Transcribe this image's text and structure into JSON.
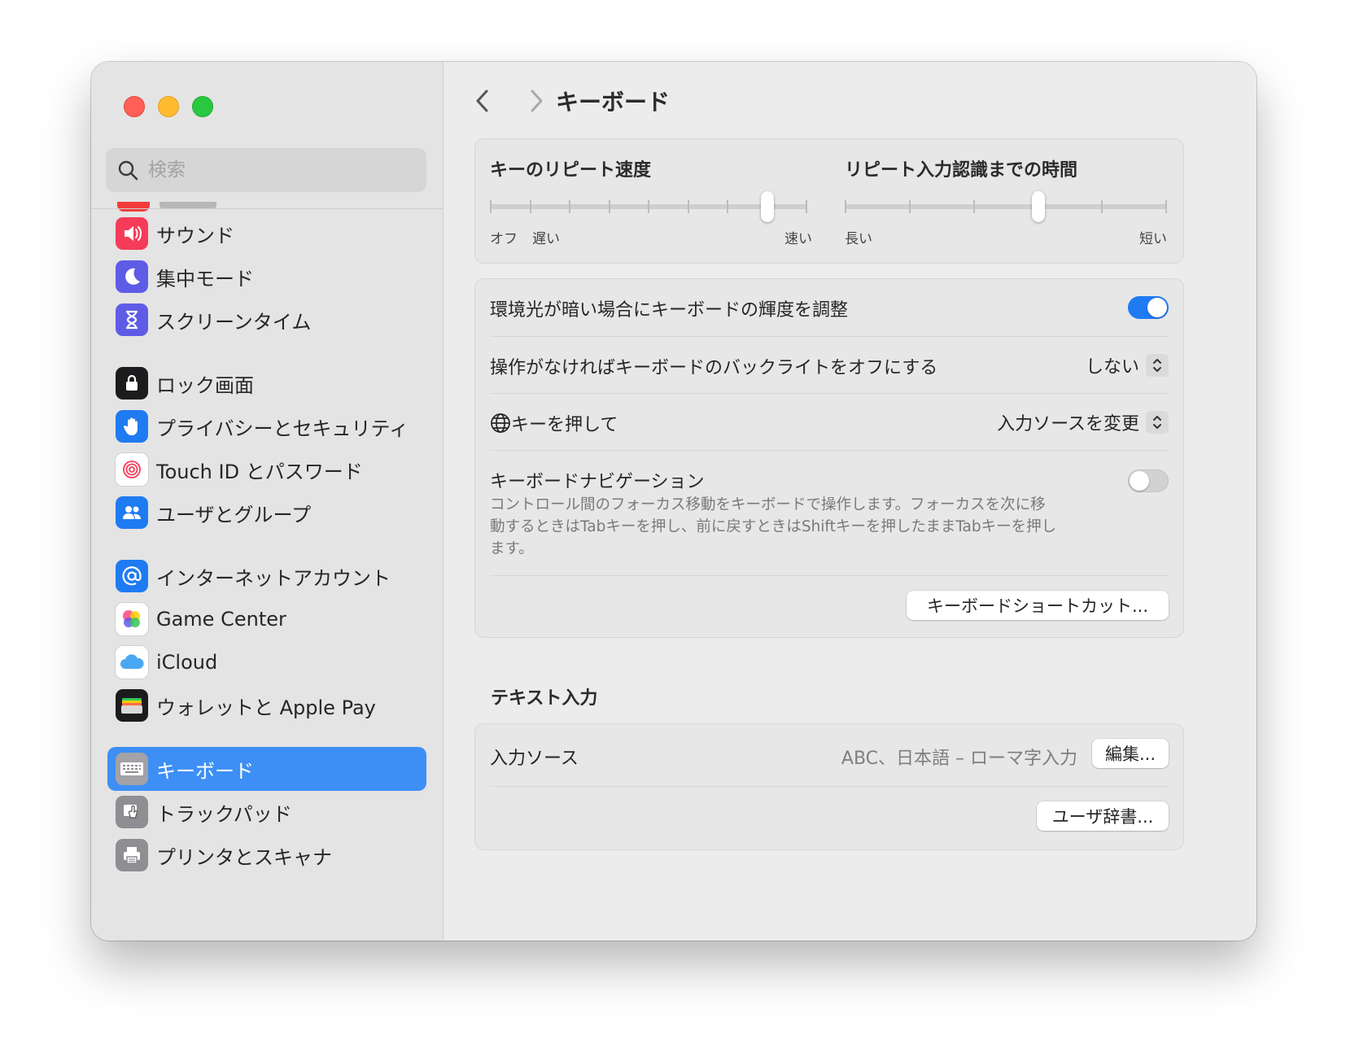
{
  "window": {
    "title": "キーボード"
  },
  "sidebar": {
    "search_placeholder": "検索",
    "items": [
      {
        "label": "サウンド",
        "icon": "speaker-icon",
        "color": "#f43c5a"
      },
      {
        "label": "集中モード",
        "icon": "moon-icon",
        "color": "#5e5ce6"
      },
      {
        "label": "スクリーンタイム",
        "icon": "hourglass-icon",
        "color": "#5e5ce6"
      },
      {
        "label": "ロック画面",
        "icon": "lock-icon",
        "color": "#1c1c1e"
      },
      {
        "label": "プライバシーとセキュリティ",
        "icon": "hand-icon",
        "color": "#1f7bf2"
      },
      {
        "label": "Touch ID とパスワード",
        "icon": "fingerprint-icon",
        "color": "#ffffff"
      },
      {
        "label": "ユーザとグループ",
        "icon": "users-icon",
        "color": "#1f7bf2"
      },
      {
        "label": "インターネットアカウント",
        "icon": "at-icon",
        "color": "#1f7bf2"
      },
      {
        "label": "Game Center",
        "icon": "game-center-icon",
        "color": "#ffffff"
      },
      {
        "label": "iCloud",
        "icon": "cloud-icon",
        "color": "#ffffff"
      },
      {
        "label": "ウォレットと Apple Pay",
        "icon": "wallet-icon",
        "color": "#1c1c1e"
      },
      {
        "label": "キーボード",
        "icon": "keyboard-icon",
        "color": "#8e8e93",
        "active": true
      },
      {
        "label": "トラックパッド",
        "icon": "trackpad-icon",
        "color": "#8e8e93"
      },
      {
        "label": "プリンタとスキャナ",
        "icon": "printer-icon",
        "color": "#8e8e93"
      }
    ]
  },
  "repeat": {
    "speed_title": "キーのリピート速度",
    "speed_labels": {
      "off": "オフ",
      "slow": "遅い",
      "fast": "速い"
    },
    "speed_level": 7,
    "speed_steps": 8,
    "delay_title": "リピート入力認識までの時間",
    "delay_labels": {
      "long": "長い",
      "short": "短い"
    },
    "delay_level": 3,
    "delay_steps": 5
  },
  "settings": {
    "brightness_label": "環境光が暗い場合にキーボードの輝度を調整",
    "brightness_on": true,
    "backlight_label": "操作がなければキーボードのバックライトをオフにする",
    "backlight_value": "しない",
    "globe_label": "キーを押して",
    "globe_value": "入力ソースを変更",
    "nav_label": "キーボードナビゲーション",
    "nav_on": false,
    "nav_desc": "コントロール間のフォーカス移動をキーボードで操作します。フォーカスを次に移動するときはTabキーを押し、前に戻すときはShiftキーを押したままTabキーを押します。",
    "shortcuts_button": "キーボードショートカット..."
  },
  "text_input": {
    "section_title": "テキスト入力",
    "sources_label": "入力ソース",
    "sources_value": "ABC、日本語 – ローマ字入力",
    "edit_button": "編集...",
    "dictionary_button": "ユーザ辞書..."
  },
  "colors": {
    "accent": "#1f7bf2",
    "sidebar_selection": "#3d8ff5"
  }
}
